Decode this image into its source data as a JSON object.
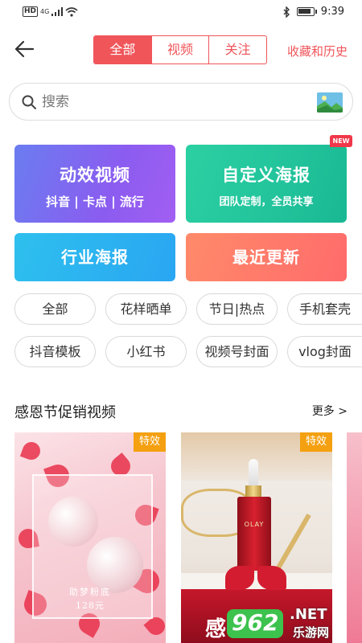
{
  "status_bar": {
    "network": "4G",
    "hd": "HD",
    "time": "9:39"
  },
  "header": {
    "tabs": [
      "全部",
      "视频",
      "关注"
    ],
    "active_tab": 0,
    "history_label": "收藏和历史"
  },
  "search": {
    "placeholder": "搜索"
  },
  "cards": [
    {
      "title": "动效视频",
      "subtitle": "抖音 | 卡点 | 流行"
    },
    {
      "title": "自定义海报",
      "subtitle": "团队定制，全员共享",
      "badge": "NEW"
    },
    {
      "title": "行业海报"
    },
    {
      "title": "最近更新"
    }
  ],
  "chips": [
    "全部",
    "花样晒单",
    "节日|热点",
    "手机套壳",
    "抖音模板",
    "小红书",
    "视频号封面",
    "vlog封面"
  ],
  "section": {
    "title": "感恩节促销视频",
    "more": "更多 >",
    "tiles": [
      {
        "tag": "特效",
        "caption": "助梦粉底",
        "price": "128元"
      },
      {
        "tag": "特效",
        "brand": "OLAY",
        "banner": "感恩"
      }
    ]
  },
  "watermark": {
    "number": "962",
    "suffix": ".NET",
    "sub": "乐游网"
  },
  "colors": {
    "accent": "#f0555a",
    "tag": "#f4a010"
  }
}
